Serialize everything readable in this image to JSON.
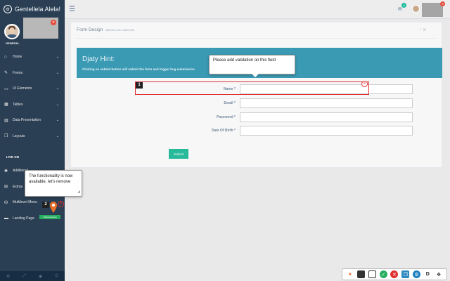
{
  "app": {
    "brand": "Gentellela Alela!"
  },
  "profile": {
    "role": "GENERAL"
  },
  "sidebar": {
    "items": [
      {
        "label": "Home",
        "icon": "home-icon",
        "glyph": "⌂"
      },
      {
        "label": "Forms",
        "icon": "edit-icon",
        "glyph": "✎"
      },
      {
        "label": "UI Elements",
        "icon": "desktop-icon",
        "glyph": "▭"
      },
      {
        "label": "Tables",
        "icon": "table-icon",
        "glyph": "▦"
      },
      {
        "label": "Data Presentation",
        "icon": "chart-icon",
        "glyph": "▥"
      },
      {
        "label": "Layouts",
        "icon": "clone-icon",
        "glyph": "❐"
      }
    ],
    "live_on": "LIVE ON",
    "items2": [
      {
        "label": "Additional",
        "icon": "bug-icon",
        "glyph": "✱"
      },
      {
        "label": "Extras",
        "icon": "windows-icon",
        "glyph": "⊞"
      },
      {
        "label": "Multilevel Menu",
        "icon": "sitemap-icon",
        "glyph": "⛁"
      },
      {
        "label": "Landing Page",
        "icon": "laptop-icon",
        "glyph": "▬"
      }
    ]
  },
  "topbar": {
    "mail_count": "6"
  },
  "panel": {
    "title": "Form Design",
    "subtitle": "different form elements"
  },
  "hint": {
    "title": "Djaty Hint:",
    "text": "Clicking on submit button will submit the form and trigger bug submission"
  },
  "form": {
    "fields": [
      {
        "label": "Name *"
      },
      {
        "label": "Email *"
      },
      {
        "label": "Password *"
      },
      {
        "label": "Date Of Birth *"
      }
    ],
    "submit_label": "Submit"
  },
  "annotations": {
    "marker1": "1",
    "tooltip1": "Please add validation on this field",
    "marker2": "2",
    "tooltip2": "The functionality is now available, let's remove",
    "pin_tag": "Clicking Event"
  },
  "colors": {
    "sidebar": "#2a3f54",
    "accent": "#26b99a",
    "hint": "#3a99b3",
    "marker": "#e03030"
  }
}
